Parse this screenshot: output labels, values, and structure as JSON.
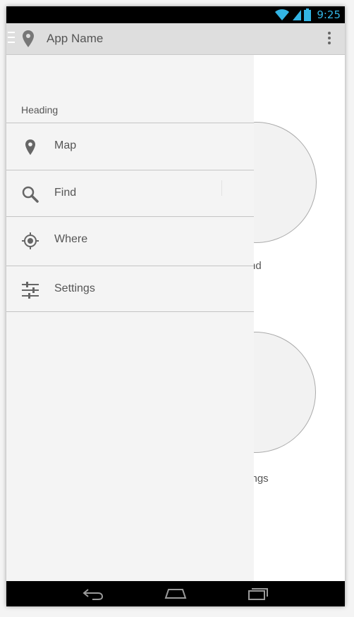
{
  "status_bar": {
    "time": "9:25",
    "icons": [
      "wifi-icon",
      "signal-icon",
      "battery-icon"
    ],
    "accent": "#33b5e5"
  },
  "action_bar": {
    "app_name": "App Name",
    "icons": [
      "hamburger-icon",
      "map-pin-icon",
      "overflow-menu-icon"
    ]
  },
  "drawer": {
    "heading": "Heading",
    "items": [
      {
        "label": "Map",
        "icon": "map-pin-icon"
      },
      {
        "label": "Find",
        "icon": "search-icon"
      },
      {
        "label": "Where",
        "icon": "crosshair-icon"
      },
      {
        "label": "Settings",
        "icon": "sliders-icon"
      }
    ]
  },
  "background": {
    "tiles": [
      {
        "label_visible": "nd"
      },
      {
        "label_visible": "tings"
      }
    ]
  },
  "nav_bar": {
    "icons": [
      "back-icon",
      "home-icon",
      "recent-apps-icon"
    ]
  }
}
